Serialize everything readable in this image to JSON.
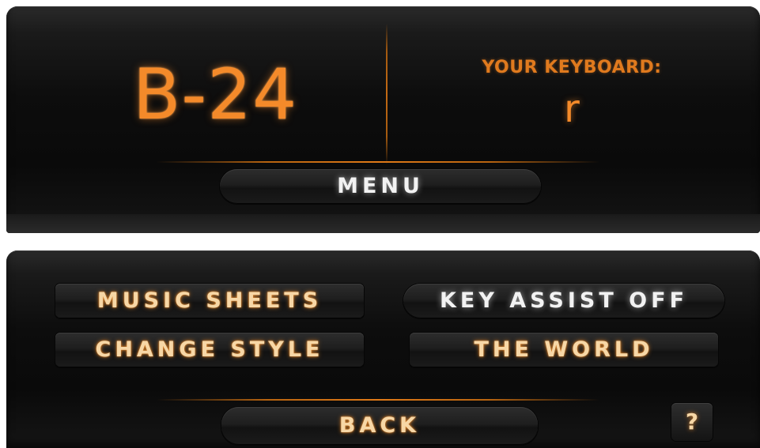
{
  "display": {
    "note": "B-24",
    "keyboard_label": "YOUR KEYBOARD:",
    "keyboard_key": "r"
  },
  "top_panel": {
    "menu_label": "MENU"
  },
  "bottom_panel": {
    "buttons": [
      {
        "label": "MUSIC SHEETS"
      },
      {
        "label": "KEY ASSIST OFF"
      },
      {
        "label": "CHANGE STYLE"
      },
      {
        "label": "THE WORLD"
      }
    ],
    "back_label": "BACK",
    "help_label": "?"
  },
  "colors": {
    "accent_orange": "#f48a2a",
    "panel_black": "#0d0d0d"
  }
}
